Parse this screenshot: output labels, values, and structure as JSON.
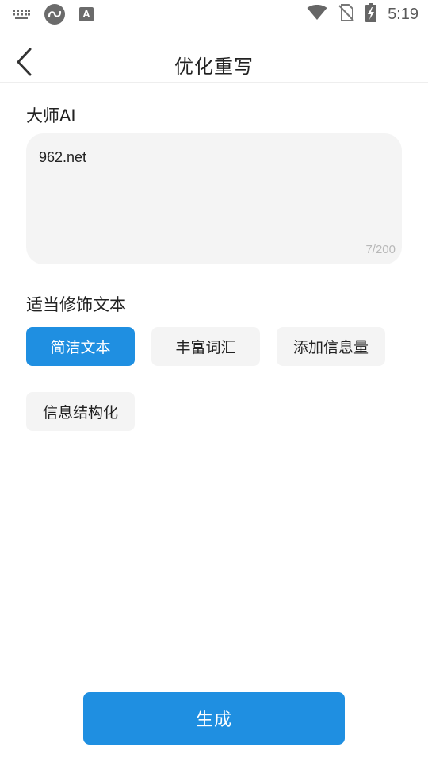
{
  "status_bar": {
    "time": "5:19",
    "icons": [
      "keyboard-icon",
      "app-circle-icon",
      "font-a-icon",
      "wifi-icon",
      "no-sim-icon",
      "battery-charging-icon"
    ]
  },
  "nav": {
    "title": "优化重写",
    "back_icon": "chevron-left-icon"
  },
  "input_section": {
    "label": "大师AI",
    "value": "962.net",
    "char_count": "7/200"
  },
  "style_section": {
    "label": "适当修饰文本",
    "options": [
      {
        "label": "简洁文本",
        "selected": true
      },
      {
        "label": "丰富词汇",
        "selected": false
      },
      {
        "label": "添加信息量",
        "selected": false
      },
      {
        "label": "信息结构化",
        "selected": false
      }
    ]
  },
  "actions": {
    "generate_label": "生成"
  },
  "colors": {
    "accent": "#1f8fe1",
    "chip_bg": "#f4f4f4",
    "text": "#222222",
    "muted": "#b8b8b8"
  }
}
